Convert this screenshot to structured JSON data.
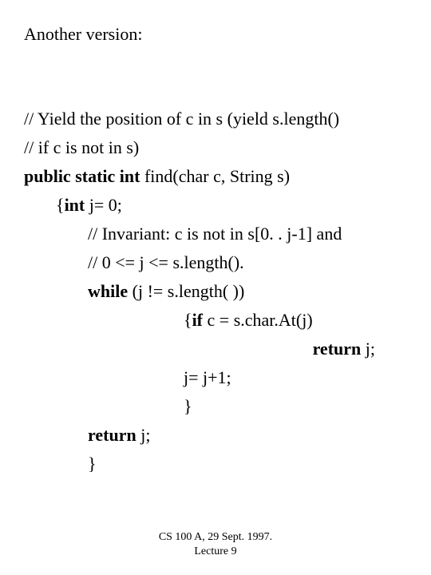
{
  "title": "Another version:",
  "lines": {
    "l1": "// Yield the position of c in s (yield s.length()",
    "l2": "//  if c is not in s)",
    "l3a": "public static int",
    "l3b": "  find(char c, String s)",
    "l4a": "{",
    "l4b": "int",
    "l4c": " j= 0;",
    "l5": "// Invariant: c is not in s[0. . j-1]  and",
    "l6": "//                    0 <= j <= s.length().",
    "l7a": "while",
    "l7b": " (j != s.length( ))",
    "l8a": "{",
    "l8b": "if",
    "l8c": " c = s.char.At(j)",
    "l9a": "return",
    "l9b": " j;",
    "l10": "j= j+1;",
    "l11": "}",
    "l12a": "return",
    "l12b": " j;",
    "l13": "}"
  },
  "footer": {
    "line1": "CS 100 A, 29 Sept. 1997.",
    "line2": "Lecture 9"
  }
}
